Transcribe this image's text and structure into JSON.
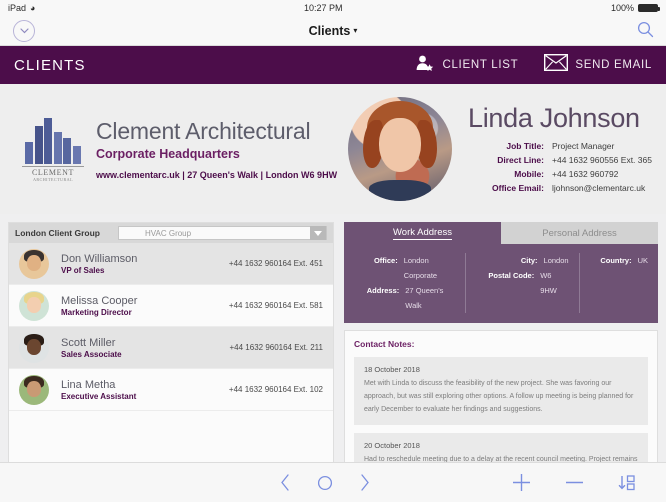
{
  "status_bar": {
    "device": "iPad",
    "wifi_icon": "wifi-icon",
    "time": "10:27 PM",
    "battery_percent": "100%",
    "battery_icon": "battery-full-icon"
  },
  "nav_bar": {
    "back_icon": "chevron-down-circle-icon",
    "title": "Clients",
    "title_caret": "▾",
    "search_icon": "search-icon"
  },
  "app_bar": {
    "title": "CLIENTS",
    "bg_color": "#4c0d4a",
    "actions": [
      {
        "label": "CLIENT LIST",
        "icon": "client-list-user-star-icon"
      },
      {
        "label": "SEND EMAIL",
        "icon": "envelope-icon"
      }
    ]
  },
  "company": {
    "logo_icon": "clement-architectural-building-logo-icon",
    "logo_name": "CLEMENT",
    "logo_sub": "ARCHITECTURAL",
    "name": "Clement Architectural",
    "subtitle": "Corporate Headquarters",
    "contact_line": "www.clementarc.uk | 27 Queen's Walk | London W6 9HW"
  },
  "person": {
    "avatar_icon": "linda-johnson-portrait-avatar",
    "name": "Linda Johnson",
    "fields": [
      {
        "key": "Job Title:",
        "value": "Project Manager"
      },
      {
        "key": "Direct Line:",
        "value": "+44 1632 960556  Ext. 365"
      },
      {
        "key": "Mobile:",
        "value": "+44 1632 960792"
      },
      {
        "key": "Office Email:",
        "value": "ljohnson@clementarc.uk"
      }
    ]
  },
  "client_list": {
    "group_label": "London Client Group",
    "group_select": {
      "value": "HVAC Group",
      "placeholder": "HVAC Group",
      "options": [
        "HVAC Group"
      ]
    },
    "rows": [
      {
        "avatar": "don-williamson-avatar",
        "name": "Don Williamson",
        "role": "VP of Sales",
        "phone": "+44 1632 960164  Ext. 451",
        "selected": true
      },
      {
        "avatar": "melissa-cooper-avatar",
        "name": "Melissa Cooper",
        "role": "Marketing Director",
        "phone": "+44 1632 960164  Ext. 581",
        "selected": false
      },
      {
        "avatar": "scott-miller-avatar",
        "name": "Scott Miller",
        "role": "Sales Associate",
        "phone": "+44 1632 960164  Ext. 211",
        "selected": true
      },
      {
        "avatar": "lina-metha-avatar",
        "name": "Lina Metha",
        "role": "Executive Assistant",
        "phone": "+44 1632 960164  Ext. 102",
        "selected": false
      }
    ]
  },
  "address_panel": {
    "tabs": [
      {
        "label": "Work Address",
        "active": true
      },
      {
        "label": "Personal Address",
        "active": false
      }
    ],
    "accent_color": "#6e5274",
    "columns": [
      {
        "rows": [
          {
            "key": "Office:",
            "value": "London Corporate"
          },
          {
            "key": "Address:",
            "value": "27 Queen's Walk"
          }
        ]
      },
      {
        "rows": [
          {
            "key": "City:",
            "value": "London"
          },
          {
            "key": "Postal Code:",
            "value": "W6 9HW"
          }
        ]
      },
      {
        "rows": [
          {
            "key": "Country:",
            "value": "UK"
          }
        ]
      }
    ]
  },
  "notes": {
    "title": "Contact Notes:",
    "items": [
      {
        "date": "18 October 2018",
        "body": "Met with Linda to discuss the feasibility of the new project. She was favoring our approach, but was still exploring other options. A follow up meeting is being planned for early December to evaluate her findings and suggestions."
      },
      {
        "date": "20 October 2018",
        "body": "Had to reschedule meeting due to a delay at the recent council meeting. Project remains on track, but we will need to compress review times to ensure deadline is not missed."
      }
    ]
  },
  "toolbar": {
    "prev_icon": "chevron-left-icon",
    "record_icon": "circle-icon",
    "next_icon": "chevron-right-icon",
    "add_icon": "plus-icon",
    "remove_icon": "minus-icon",
    "sort_icon": "sort-az-descending-icon",
    "accent_color": "#7b8fe0"
  }
}
